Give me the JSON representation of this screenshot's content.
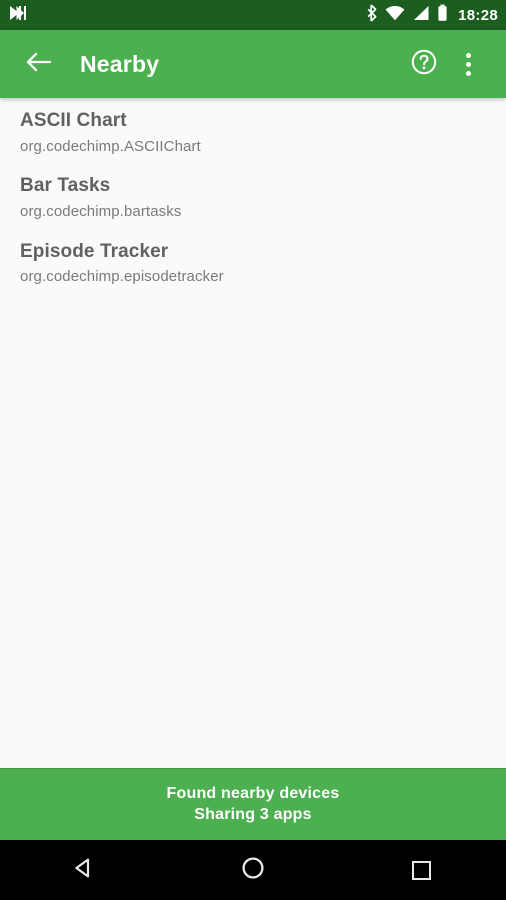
{
  "status_bar": {
    "background": "#1B5E20",
    "notification_icon": "skip-next-icon",
    "icons": [
      "bluetooth-icon",
      "wifi-icon",
      "cellular-signal-icon",
      "battery-icon"
    ],
    "clock": "18:28"
  },
  "toolbar": {
    "background": "#4CAF50",
    "back_label": "back-arrow-icon",
    "title": "Nearby",
    "help_label": "help-icon",
    "overflow_label": "more-options-icon"
  },
  "app_list": {
    "background": "#FAFAFA",
    "items": [
      {
        "name": "ASCII Chart",
        "package": "org.codechimp.ASCIIChart"
      },
      {
        "name": "Bar Tasks",
        "package": "org.codechimp.bartasks"
      },
      {
        "name": "Episode Tracker",
        "package": "org.codechimp.episodetracker"
      }
    ]
  },
  "status_banner": {
    "background": "#4CAF50",
    "line1": "Found nearby devices",
    "line2": "Sharing 3 apps"
  },
  "nav_bar": {
    "background": "#000000",
    "back": "back-triangle-icon",
    "home": "home-circle-icon",
    "recents": "recents-square-icon"
  }
}
